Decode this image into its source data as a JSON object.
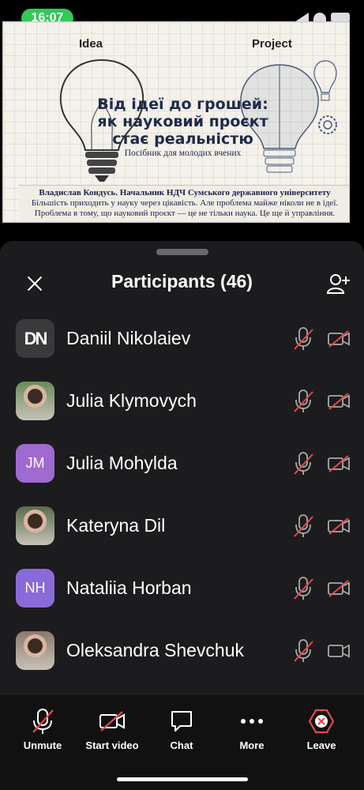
{
  "status_bar": {
    "time": "16:07"
  },
  "slide": {
    "left_heading": "Idea",
    "right_heading": "Project",
    "title_lines": [
      "Від ідеї до грошей:",
      "як науковий проєкт",
      "стає реальністю"
    ],
    "subtitle": "Посібник для молодих вчених",
    "footer_author": "Владислав Кондусь. Начальник НДЧ Сумського державного університету",
    "footer_line2": "Більшість приходить у науку через цікавість. Але проблема майже ніколи не в ідеї.",
    "footer_line3": "Проблема в тому, що науковий проєкт — це не тільки наука. Це ще й управління."
  },
  "participants_panel": {
    "title": "Participants (46)",
    "participants": [
      {
        "name": "Daniil Nikolaiev",
        "avatar_text": "DN",
        "avatar_type": "logo",
        "avatar_color": "#3a3a3c",
        "mic": "muted",
        "video": "off"
      },
      {
        "name": "Julia Klymovych",
        "avatar_text": "",
        "avatar_type": "photo",
        "avatar_color": "#6b8a5a",
        "mic": "muted",
        "video": "off"
      },
      {
        "name": "Julia Mohylda",
        "avatar_text": "JM",
        "avatar_type": "initials",
        "avatar_color": "#a06ad0",
        "mic": "muted",
        "video": "off"
      },
      {
        "name": "Kateryna Dil",
        "avatar_text": "",
        "avatar_type": "photo",
        "avatar_color": "#5a6a4a",
        "mic": "muted",
        "video": "off"
      },
      {
        "name": "Nataliia Horban",
        "avatar_text": "NH",
        "avatar_type": "initials",
        "avatar_color": "#8a6ad8",
        "mic": "muted",
        "video": "off"
      },
      {
        "name": "Oleksandra Shevchuk",
        "avatar_text": "",
        "avatar_type": "photo",
        "avatar_color": "#8a7a6a",
        "mic": "muted",
        "video": "available"
      }
    ]
  },
  "toolbar": {
    "unmute_label": "Unmute",
    "start_video_label": "Start video",
    "chat_label": "Chat",
    "more_label": "More",
    "leave_label": "Leave"
  },
  "colors": {
    "muted_slash": "#e5484d",
    "leave": "#e5484d",
    "time_pill": "#34c759",
    "sheet_bg": "#1c1c1e"
  }
}
